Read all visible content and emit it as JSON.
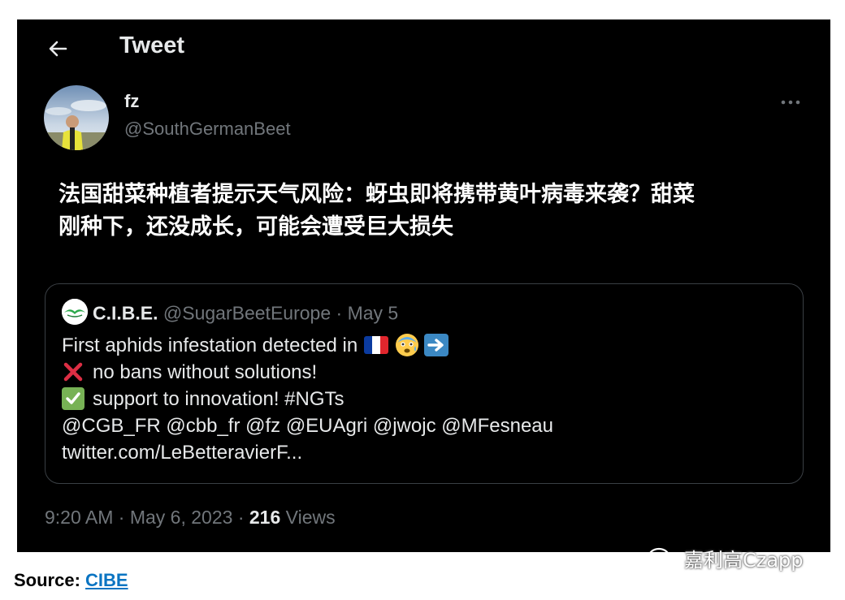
{
  "header": {
    "title": "Tweet",
    "back_icon": "arrow-left-icon"
  },
  "author": {
    "name": "fz",
    "handle": "@SouthGermanBeet",
    "more_icon": "more-horizontal-icon"
  },
  "tweet": {
    "text_line1": "法国甜菜种植者提示天气风险：蚜虫即将携带黄叶病毒来袭？甜菜",
    "text_line2": "刚种下，还没成长，可能会遭受巨大损失"
  },
  "quote": {
    "name": "C.I.B.E.",
    "handle": "@SugarBeetEurope",
    "separator": "·",
    "date": "May 5",
    "line1": "First aphids infestation detected in",
    "line2": "no bans without solutions!",
    "line3": "support to innovation! #NGTs",
    "line4": "@CGB_FR @cbb_fr @fz @EUAgri @jwojc @MFesneau",
    "line5": "twitter.com/LeBetteravierF...",
    "flag_colors": [
      "#0b3b9f",
      "#ffffff",
      "#e1262d"
    ]
  },
  "meta": {
    "time": "9:20 AM",
    "sep1": "·",
    "date": "May 6, 2023",
    "sep2": "·",
    "views_count": "216",
    "views_label": "Views"
  },
  "footer": {
    "source_label": "Source:",
    "source_link": "CIBE"
  },
  "watermark": {
    "text": "嘉利高Czapp",
    "icon": "wechat-icon"
  },
  "colors": {
    "background": "#000000",
    "text": "#e7e9ea",
    "muted": "#71767b",
    "link": "#0a74c2"
  }
}
